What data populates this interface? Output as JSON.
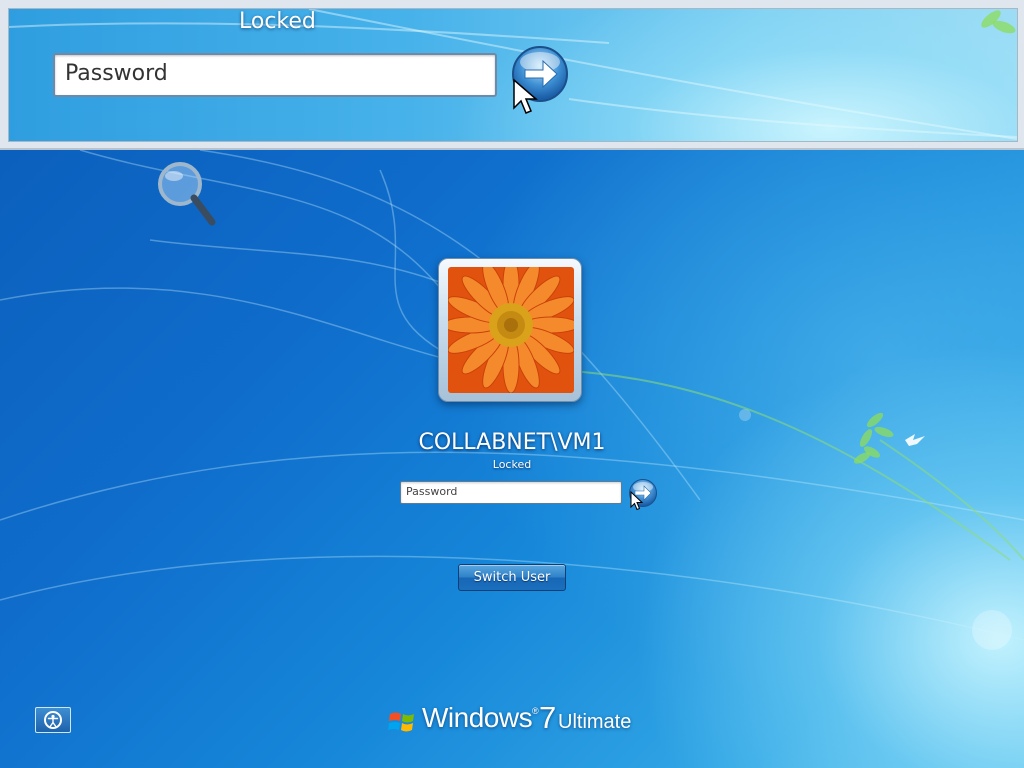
{
  "zoom": {
    "status": "Locked",
    "password_placeholder": "Password"
  },
  "user": {
    "name": "COLLABNET\\VM1",
    "status": "Locked"
  },
  "password": {
    "placeholder": "Password",
    "value": ""
  },
  "buttons": {
    "switch_user": "Switch User"
  },
  "icons": {
    "submit": "arrow-right-icon",
    "ease_of_access": "ease-of-access-icon",
    "magnifier": "magnifier-icon",
    "windows_logo": "windows-flag-icon"
  },
  "branding": {
    "product": "Windows",
    "version": "7",
    "edition": "Ultimate"
  },
  "colors": {
    "background": "#1a7ad0",
    "button": "#2f82c9",
    "avatar_flower": "#f26a1b"
  }
}
